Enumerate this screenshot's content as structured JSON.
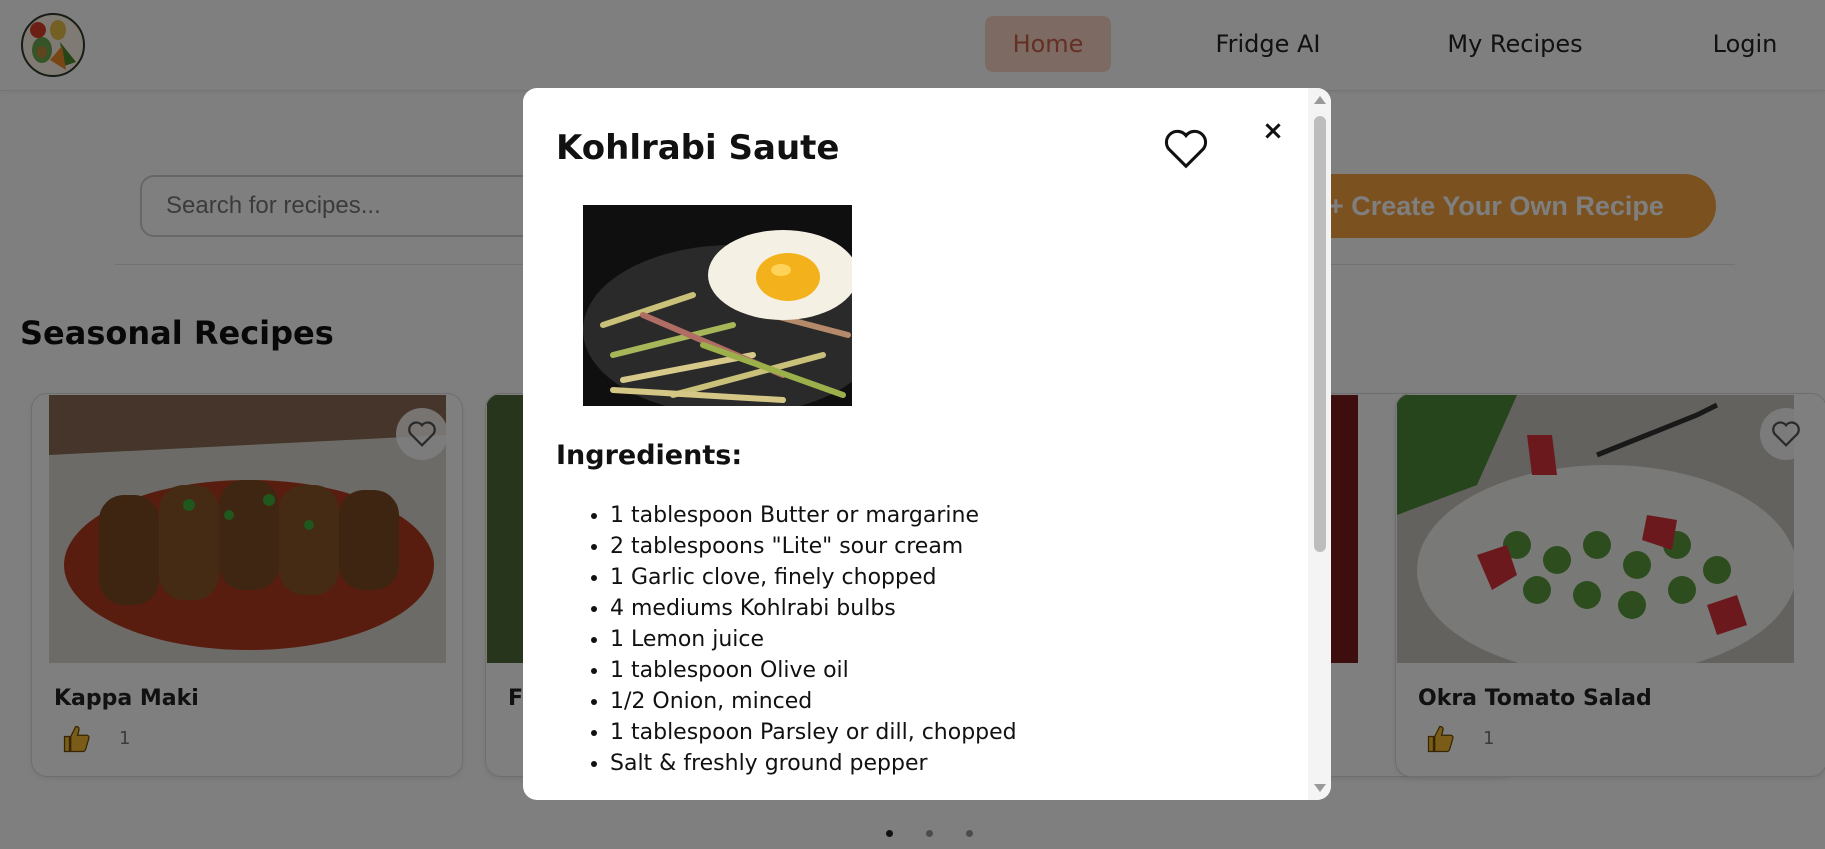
{
  "header": {
    "nav": [
      {
        "label": "Home",
        "active": true
      },
      {
        "label": "Fridge AI"
      },
      {
        "label": "My Recipes"
      },
      {
        "label": "Login"
      }
    ]
  },
  "search": {
    "placeholder": "Search for recipes..."
  },
  "create_button": {
    "label": "+ Create Your Own Recipe"
  },
  "section": {
    "title": "Seasonal Recipes"
  },
  "cards": [
    {
      "title": "Kappa Maki",
      "likes": "1"
    },
    {
      "title": "Fr"
    },
    {
      "title": ""
    },
    {
      "title": "Okra Tomato Salad",
      "likes": "1"
    }
  ],
  "pagination": {
    "dots": 3,
    "active_index": 0
  },
  "modal": {
    "title": "Kohlrabi Saute",
    "close_label": "×",
    "ingredients_title": "Ingredients:",
    "ingredients": [
      "1 tablespoon Butter or margarine",
      "2 tablespoons \"Lite\" sour cream",
      "1 Garlic clove, finely chopped",
      "4 mediums Kohlrabi bulbs",
      "1 Lemon juice",
      "1 tablespoon Olive oil",
      "1/2 Onion, minced",
      "1 tablespoon Parsley or dill, chopped",
      "Salt & freshly ground pepper"
    ]
  },
  "colors": {
    "accent": "#f7a23f",
    "nav_active_bg": "#fbd4c4",
    "nav_active_text": "#c8614a"
  },
  "icons": [
    "logo-icon",
    "heart-icon",
    "close-icon",
    "thumbs-up-icon"
  ]
}
